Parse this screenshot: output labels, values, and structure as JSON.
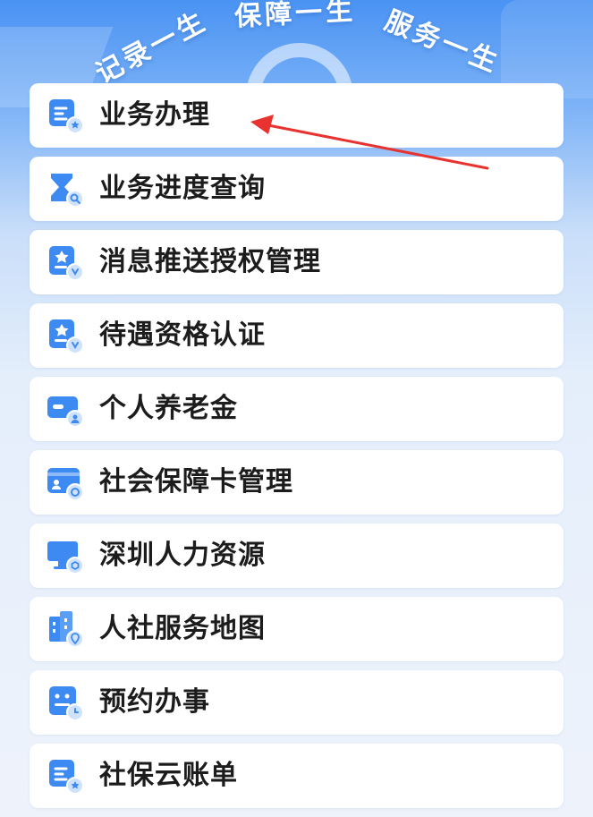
{
  "header": {
    "slogans": [
      "记录一生",
      "保障一生",
      "服务一生"
    ]
  },
  "menu": {
    "items": [
      {
        "label": "业务办理",
        "icon": "business-handling-icon"
      },
      {
        "label": "业务进度查询",
        "icon": "progress-query-icon"
      },
      {
        "label": "消息推送授权管理",
        "icon": "message-auth-icon"
      },
      {
        "label": "待遇资格认证",
        "icon": "qualification-cert-icon"
      },
      {
        "label": "个人养老金",
        "icon": "pension-card-icon"
      },
      {
        "label": "社会保障卡管理",
        "icon": "social-security-card-icon"
      },
      {
        "label": "深圳人力资源",
        "icon": "monitor-icon"
      },
      {
        "label": "人社服务地图",
        "icon": "building-map-icon"
      },
      {
        "label": "预约办事",
        "icon": "appointment-icon"
      },
      {
        "label": "社保云账单",
        "icon": "cloud-bill-icon"
      }
    ]
  },
  "colors": {
    "accent": "#3d8af2",
    "annotation_arrow": "#e8322f"
  }
}
